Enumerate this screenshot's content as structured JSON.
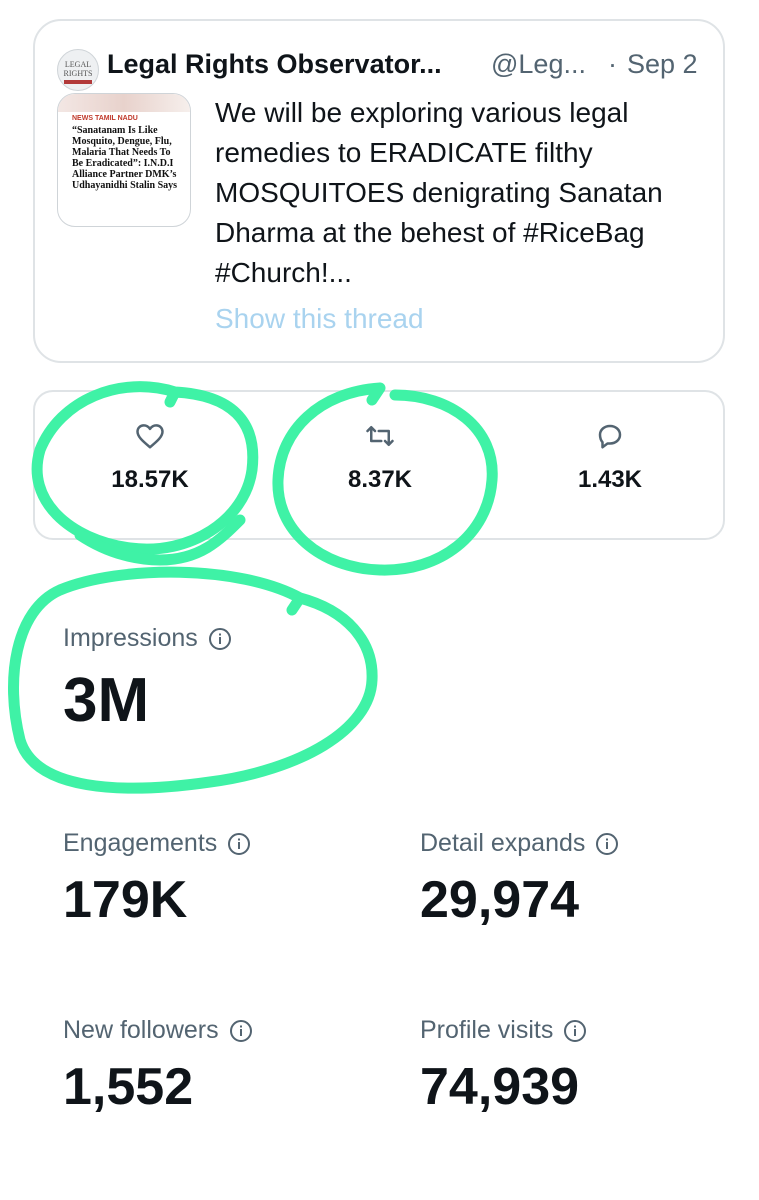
{
  "tweet": {
    "author": "Legal Rights Observator...",
    "handle": "@Leg...",
    "separator": "·",
    "date": "Sep 2",
    "text": "We will be exploring various legal remedies to ERADICATE filthy MOSQUITOES denigrating Sanatan Dharma at the behest of #RiceBag #Church!...",
    "show_thread": "Show this thread",
    "thumb_tag": "NEWS  TAMIL NADU",
    "thumb_headline": "“Sanatanam Is Like Mosquito, Dengue, Flu, Malaria That Needs To Be Eradicated”: I.N.D.I Alliance Partner DMK’s Udhayanidhi Stalin Says",
    "avatar_text": "LEGAL RIGHTS"
  },
  "engagement": {
    "likes": "18.57K",
    "retweets": "8.37K",
    "replies": "1.43K"
  },
  "metrics": {
    "impressions": {
      "label": "Impressions",
      "value": "3M"
    },
    "engagements": {
      "label": "Engagements",
      "value": "179K"
    },
    "detail_expands": {
      "label": "Detail expands",
      "value": "29,974"
    },
    "new_followers": {
      "label": "New followers",
      "value": "1,552"
    },
    "profile_visits": {
      "label": "Profile visits",
      "value": "74,939"
    }
  },
  "colors": {
    "annotation": "#3ff2a6",
    "muted": "#536471",
    "link": "#a9d3ef"
  },
  "icons": [
    "heart-icon",
    "retweet-icon",
    "reply-icon",
    "info-icon"
  ]
}
